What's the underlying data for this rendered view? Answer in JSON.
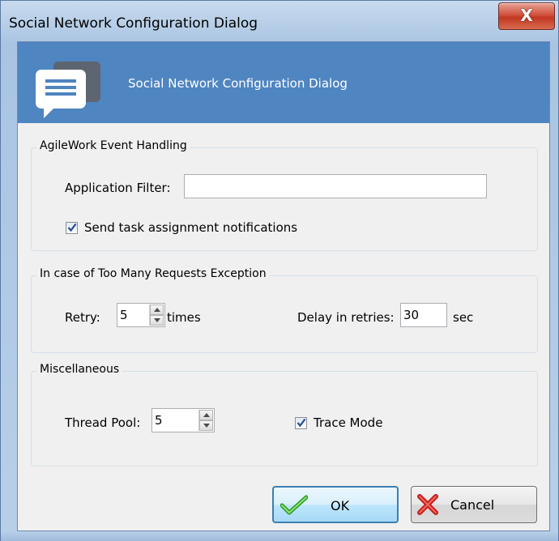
{
  "window": {
    "title": "Social Network Configuration Dialog",
    "close_glyph": "X"
  },
  "banner": {
    "title": "Social Network Configuration Dialog",
    "icon": "chat-bubble-icon",
    "color": "#4f85c0"
  },
  "event_handling": {
    "legend": "AgileWork Event Handling",
    "filter_label": "Application Filter:",
    "filter_value": "",
    "send_notifications_label": "Send task assignment notifications",
    "send_notifications_checked": true
  },
  "too_many_requests": {
    "legend": "In case of Too Many Requests Exception",
    "retry_label": "Retry:",
    "retry_value": "5",
    "retry_unit": "times",
    "delay_label": "Delay in retries:",
    "delay_value": "30",
    "delay_unit": "sec"
  },
  "misc": {
    "legend": "Miscellaneous",
    "thread_pool_label": "Thread Pool:",
    "thread_pool_value": "5",
    "trace_mode_label": "Trace Mode",
    "trace_mode_checked": true
  },
  "buttons": {
    "ok_label": "OK",
    "ok_icon": "green-checkmark-icon",
    "cancel_label": "Cancel",
    "cancel_icon": "red-x-icon"
  }
}
